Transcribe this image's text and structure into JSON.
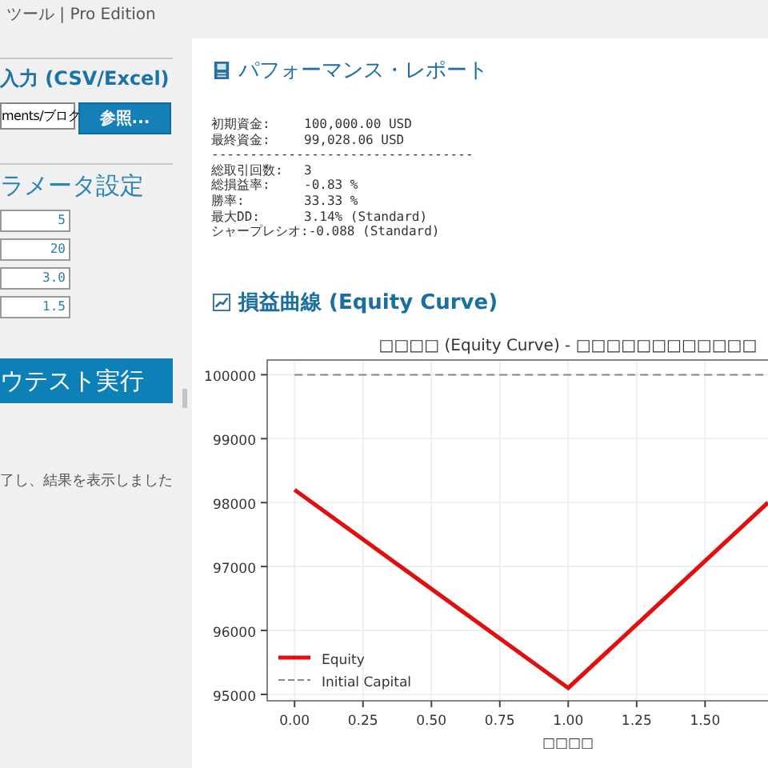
{
  "window": {
    "title": "ツール | Pro Edition"
  },
  "input_section": {
    "heading": "入力 (CSV/Excel)",
    "file_path": "ments/ブログ",
    "browse_button": "参照..."
  },
  "params_section": {
    "heading": "ラメータ設定",
    "fields": [
      "5",
      "20",
      "3.0",
      "1.5"
    ]
  },
  "run_button": "ウテスト実行",
  "status": "了し、結果を表示しました",
  "report": {
    "heading": "パフォーマンス・レポート",
    "rows": [
      {
        "kind": "pair",
        "label": "初期資金:",
        "value": "100,000.00 USD"
      },
      {
        "kind": "pair",
        "label": "最終資金:",
        "value": "99,028.06 USD"
      },
      {
        "kind": "rule",
        "text": "----------------------------------"
      },
      {
        "kind": "pair",
        "label": "総取引回数:",
        "value": "3"
      },
      {
        "kind": "pair",
        "label": "総損益率:",
        "value": "-0.83 %"
      },
      {
        "kind": "pair",
        "label": "勝率:",
        "value": "33.33 %"
      },
      {
        "kind": "pair",
        "label": "最大DD:",
        "value": "3.14% (Standard)"
      },
      {
        "kind": "pair",
        "label": "シャープレシオ:",
        "value": "-0.088 (Standard)"
      }
    ]
  },
  "equity": {
    "heading": "損益曲線 (Equity Curve)",
    "chart_data": {
      "type": "line",
      "title": "□□□□ (Equity Curve) - □□□□□□□□□□□□",
      "xlabel": "□□□□",
      "x": [
        0,
        1,
        1.73
      ],
      "xlim": [
        -0.1,
        1.73
      ],
      "ylim": [
        94900,
        100230
      ],
      "grid": true,
      "legend": true,
      "series": [
        {
          "name": "Equity",
          "color": "#e01010",
          "line_style": "solid",
          "values": [
            98200,
            95100,
            98000
          ]
        },
        {
          "name": "Initial Capital",
          "color": "#888888",
          "line_style": "dashed",
          "values": [
            100000,
            100000,
            100000
          ]
        }
      ],
      "yticks": [
        95000,
        96000,
        97000,
        98000,
        99000,
        100000
      ],
      "xticks": [
        {
          "value": 0,
          "label": "0.00"
        },
        {
          "value": 0.25,
          "label": "0.25"
        },
        {
          "value": 0.5,
          "label": "0.50"
        },
        {
          "value": 0.75,
          "label": "0.75"
        },
        {
          "value": 1,
          "label": "1.00"
        },
        {
          "value": 1.25,
          "label": "1.25"
        },
        {
          "value": 1.5,
          "label": "1.50"
        }
      ]
    }
  }
}
